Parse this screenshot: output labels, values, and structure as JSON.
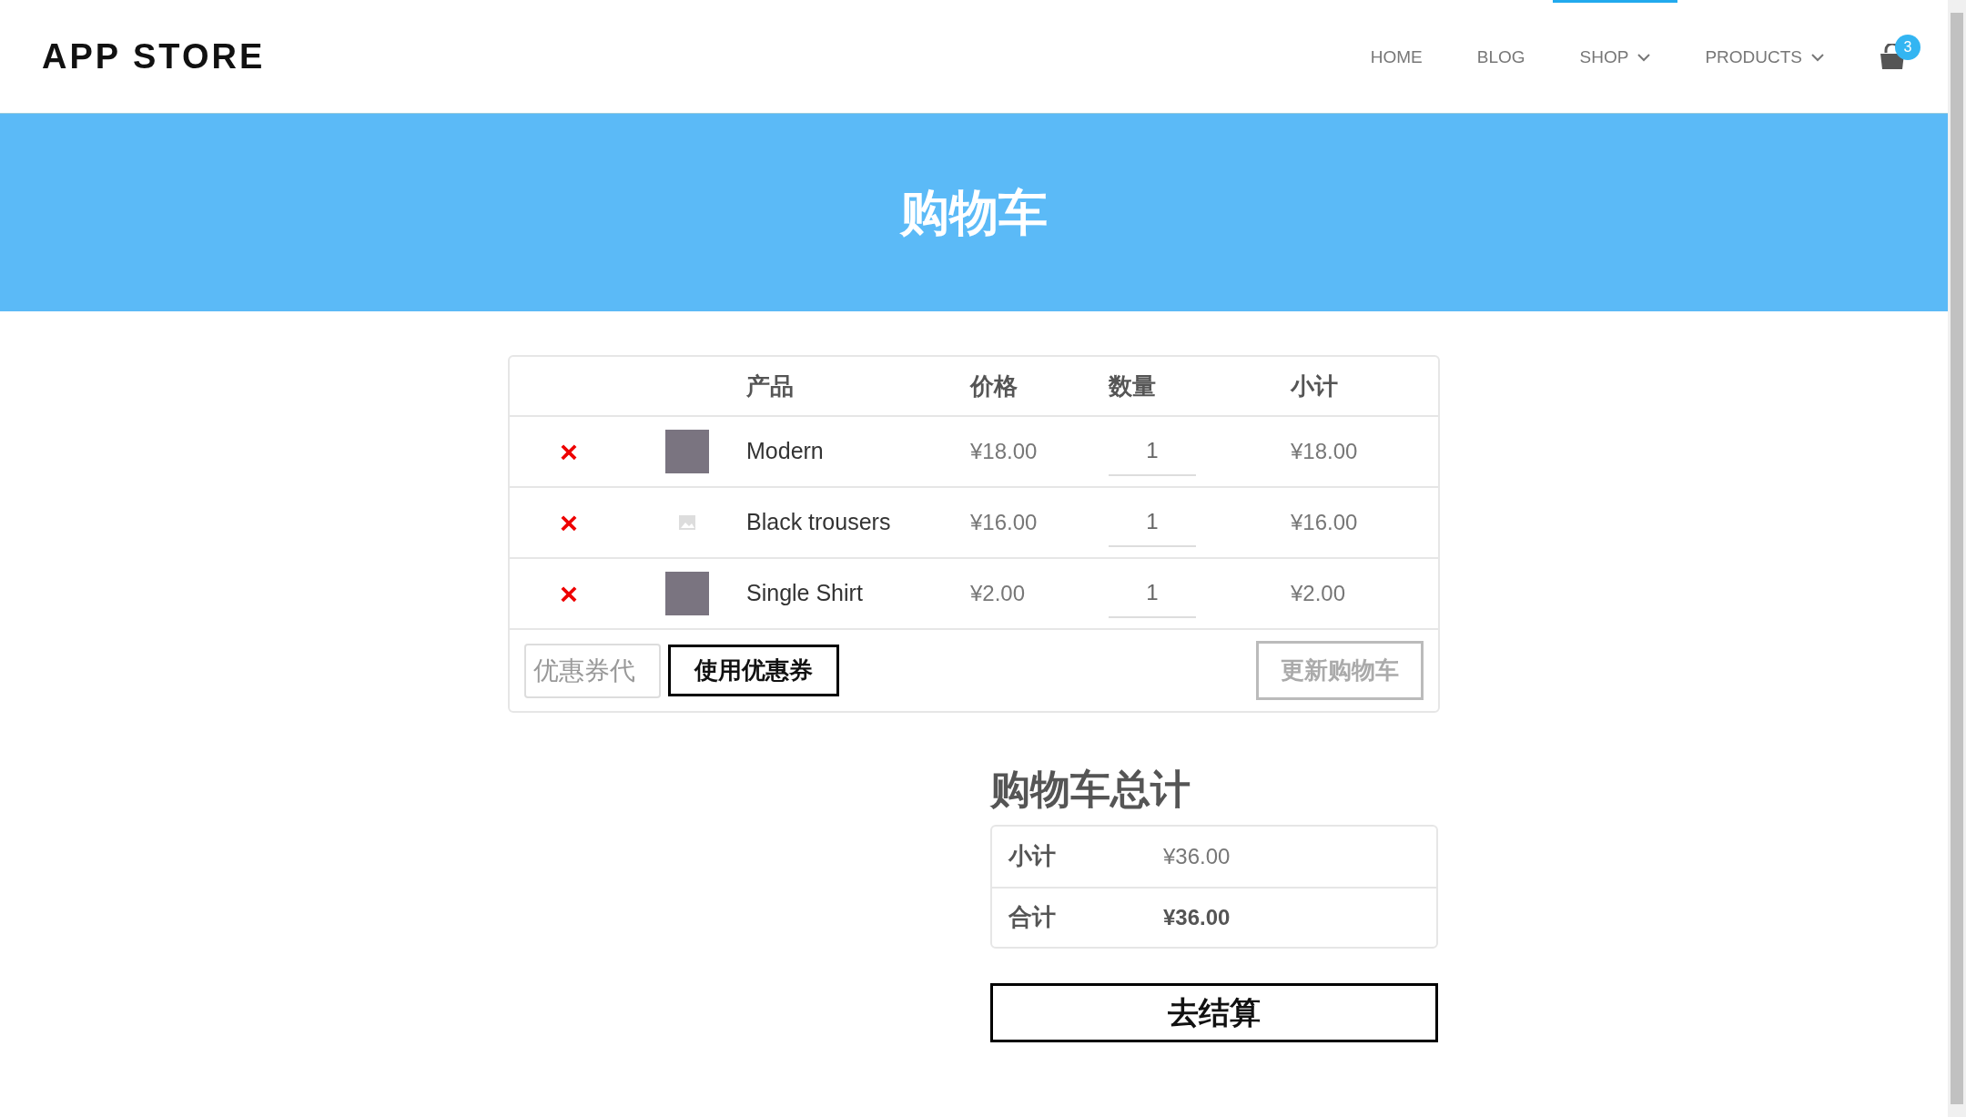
{
  "brand": "APP STORE",
  "nav": [
    {
      "label": "HOME",
      "selected": false,
      "dropdown": false
    },
    {
      "label": "BLOG",
      "selected": false,
      "dropdown": false
    },
    {
      "label": "SHOP",
      "selected": true,
      "dropdown": true
    },
    {
      "label": "PRODUCTS",
      "selected": false,
      "dropdown": true
    }
  ],
  "cart_count": "3",
  "banner": {
    "title": "购物车"
  },
  "cart": {
    "columns": [
      "产品",
      "价格",
      "数量",
      "小计"
    ],
    "rows": [
      {
        "remove": "×",
        "kind": "photo",
        "product": "Modern",
        "price": "¥18.00",
        "quantity": "1",
        "subtotal": "¥18.00"
      },
      {
        "remove": "×",
        "kind": "missing",
        "product": "Black trousers",
        "price": "¥16.00",
        "quantity": "1",
        "subtotal": "¥16.00"
      },
      {
        "remove": "×",
        "kind": "photo",
        "product": "Single Shirt",
        "price": "¥2.00",
        "quantity": "1",
        "subtotal": "¥2.00"
      }
    ],
    "coupon": {
      "placeholder": "优惠券代"
    },
    "apply_button": "使用优惠券",
    "update_button": {
      "label": "更新购物车",
      "disabled": true
    }
  },
  "totals": {
    "title": "购物车总计",
    "rows": [
      {
        "label": "小计",
        "value": "¥36.00",
        "kind": "plain"
      },
      {
        "label": "合计",
        "value": "¥36.00",
        "kind": "bold"
      }
    ],
    "checkout": "去结算"
  }
}
